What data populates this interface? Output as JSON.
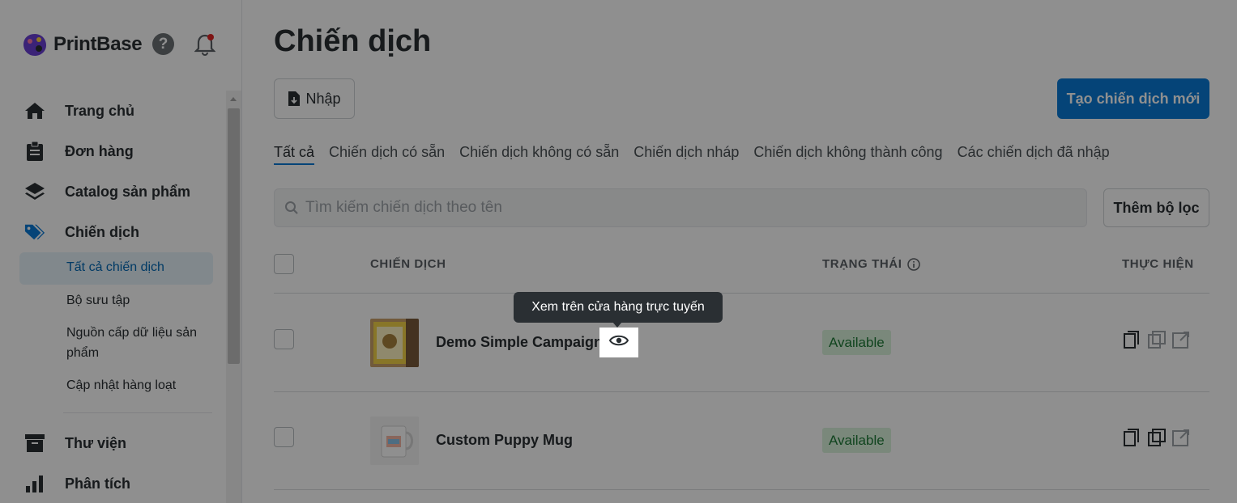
{
  "brand": {
    "name": "PrintBase"
  },
  "sidebar": {
    "items": [
      {
        "label": "Trang chủ",
        "icon": "home-icon"
      },
      {
        "label": "Đơn hàng",
        "icon": "clipboard-icon"
      },
      {
        "label": "Catalog sản phẩm",
        "icon": "layers-icon"
      },
      {
        "label": "Chiến dịch",
        "icon": "tag-icon"
      },
      {
        "label": "Thư viện",
        "icon": "archive-icon"
      },
      {
        "label": "Phân tích",
        "icon": "bar-chart-icon"
      }
    ],
    "subitems": [
      {
        "label": "Tất cả chiến dịch"
      },
      {
        "label": "Bộ sưu tập"
      },
      {
        "label": "Nguồn cấp dữ liệu sản phẩm"
      },
      {
        "label": "Cập nhật hàng loạt"
      }
    ]
  },
  "main": {
    "title": "Chiến dịch",
    "import_label": "Nhập",
    "create_label": "Tạo chiến dịch mới",
    "tabs": [
      {
        "label": "Tất cả"
      },
      {
        "label": "Chiến dịch có sẵn"
      },
      {
        "label": "Chiến dịch không có sẵn"
      },
      {
        "label": "Chiến dịch nháp"
      },
      {
        "label": "Chiến dịch không thành công"
      },
      {
        "label": "Các chiến dịch đã nhập"
      }
    ],
    "search_placeholder": "Tìm kiếm chiến dịch theo tên",
    "filter_label": "Thêm bộ lọc",
    "table": {
      "headers": {
        "campaign": "CHIẾN DỊCH",
        "status": "TRẠNG THÁI",
        "actions": "THỰC HIỆN"
      },
      "rows": [
        {
          "name": "Demo Simple Campaign",
          "status": "Available"
        },
        {
          "name": "Custom Puppy Mug",
          "status": "Available"
        }
      ]
    },
    "tooltip": "Xem trên cửa hàng trực tuyến"
  },
  "colors": {
    "accent": "#0a7ad6",
    "status_bg": "#d9f2dc",
    "status_text": "#1d7a36"
  }
}
